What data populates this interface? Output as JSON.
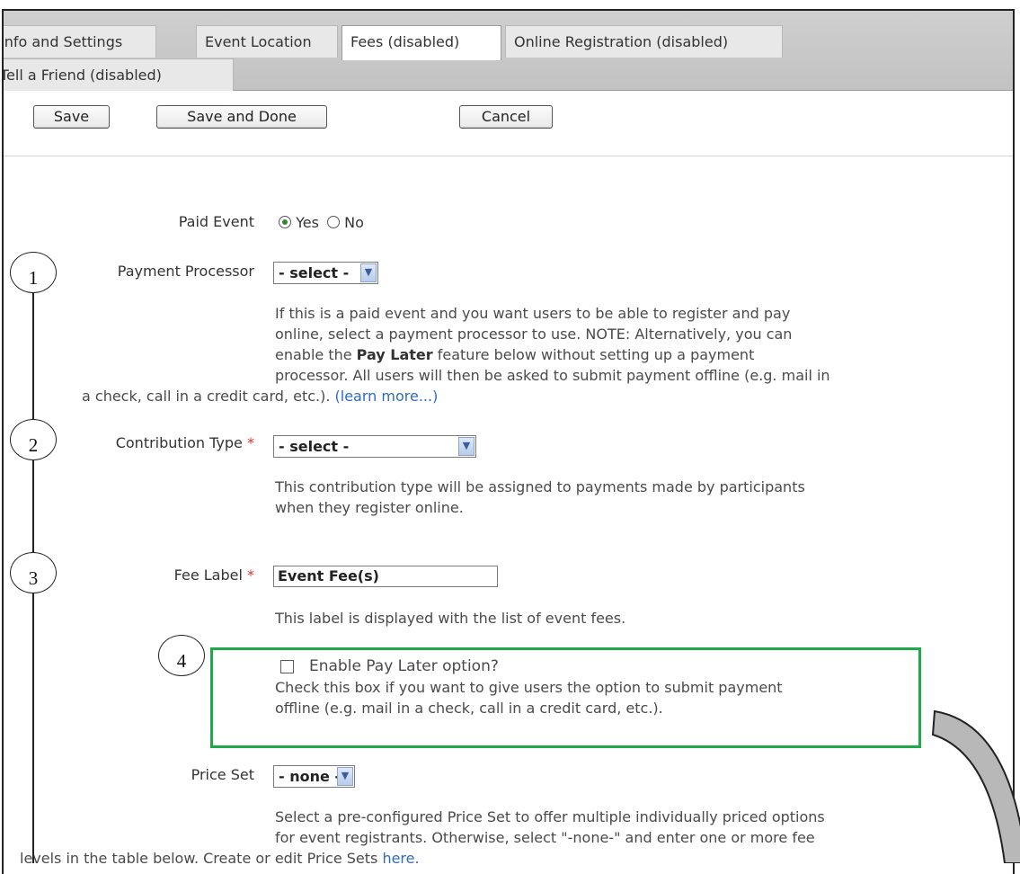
{
  "tabs": [
    {
      "label": "Info and Settings"
    },
    {
      "label": "Event Location"
    },
    {
      "label": "Fees (disabled)"
    },
    {
      "label": "Online Registration (disabled)"
    },
    {
      "label": "Tell a Friend (disabled)"
    }
  ],
  "toolbar": {
    "save": "Save",
    "save_done": "Save and Done",
    "cancel": "Cancel"
  },
  "form": {
    "paid_event": {
      "label": "Paid Event",
      "yes": "Yes",
      "no": "No",
      "selected": "Yes"
    },
    "payment_processor": {
      "label": "Payment Processor",
      "value": "- select -",
      "help_1": "If this is a paid event and you want users to be able to register and pay",
      "help_2": "online, select a payment processor to use. NOTE: Alternatively, you can",
      "help_3a": "enable the ",
      "help_3b": "Pay Later",
      "help_3c": " feature below without setting up a payment",
      "help_4": "processor. All users will then be asked to submit payment offline (e.g. mail in",
      "help_5": "a check, call in a credit card, etc.). ",
      "learn_more": "(learn more...)"
    },
    "contribution_type": {
      "label": "Contribution Type",
      "required": "*",
      "value": "- select -",
      "help_1": "This contribution type will be assigned to payments made by participants",
      "help_2": "when they register online."
    },
    "fee_label": {
      "label": "Fee Label",
      "required": "*",
      "value": "Event Fee(s)",
      "help": "This label is displayed with the list of event fees."
    },
    "pay_later": {
      "label": "Enable Pay Later option?",
      "checked": false,
      "help_1": "Check this box if you want to give users the option to submit payment",
      "help_2": "offline (e.g. mail in a check, call in a credit card, etc.)."
    },
    "price_set": {
      "label": "Price Set",
      "value": "- none -",
      "help_1": "Select a pre-configured Price Set to offer multiple individually priced options",
      "help_2": "for event registrants. Otherwise, select \"-none-\" and enter one or more fee",
      "help_3": "levels in the table below. Create or edit Price Sets ",
      "here": "here."
    }
  },
  "callouts": [
    "1",
    "2",
    "3",
    "4"
  ],
  "colors": {
    "highlight_box": "#1faa4a",
    "link": "#2e6bbf",
    "required": "#e03131"
  }
}
